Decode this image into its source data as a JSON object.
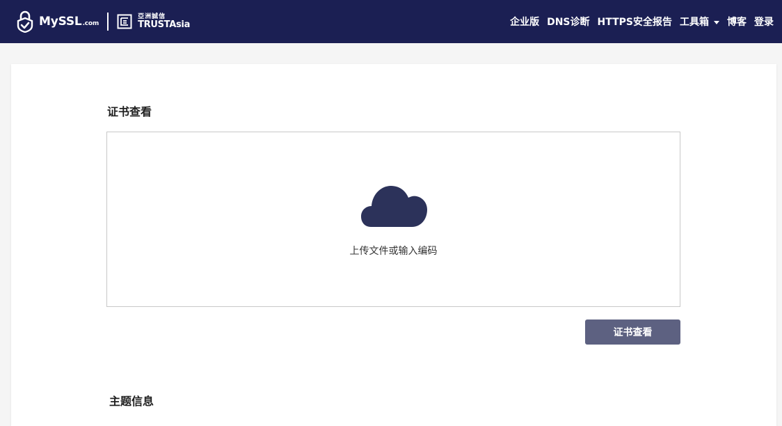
{
  "header": {
    "brand_myssl": "MySSL",
    "brand_dotcom": ".com",
    "brand_ta_cn": "亞洲誠信",
    "brand_ta_en": "TRUSTAsia",
    "nav": [
      {
        "label": "企业版"
      },
      {
        "label": "DNS诊断"
      },
      {
        "label": "HTTPS安全报告"
      },
      {
        "label": "工具箱"
      },
      {
        "label": "博客"
      },
      {
        "label": "登录"
      }
    ]
  },
  "main": {
    "section_title": "证书查看",
    "dropzone": {
      "icon": "cloud-upload-icon",
      "hint": "上传文件或输入编码"
    },
    "submit_label": "证书查看",
    "next_section_title": "主题信息"
  },
  "colors": {
    "header_bg": "#1b1f53",
    "cloud": "#2c325a",
    "button_bg": "#5d6181"
  }
}
